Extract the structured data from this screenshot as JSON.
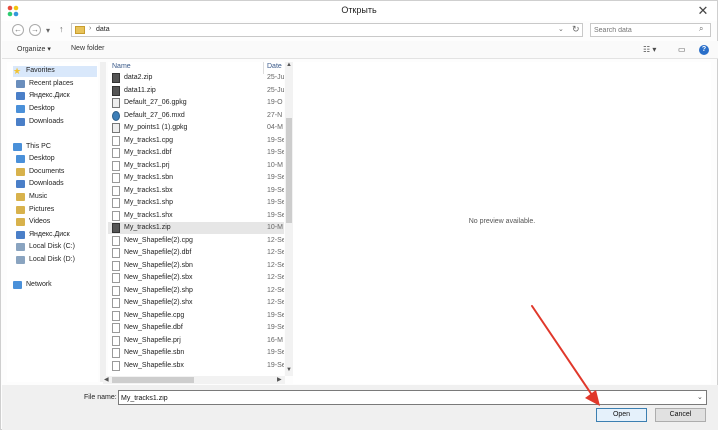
{
  "window": {
    "title": "Открыть",
    "close_glyph": "✕",
    "app_icon": "app-icon"
  },
  "address_bar": {
    "back_glyph": "←",
    "forward_glyph": "→",
    "recent_glyph": "▾",
    "up_glyph": "↑",
    "breadcrumb_separator": "›",
    "path": "data",
    "dropdown_glyph": "⌄",
    "refresh_glyph": "↻"
  },
  "search": {
    "placeholder": "Search data",
    "icon_glyph": "⌕"
  },
  "toolbar": {
    "organize_label": "Organize ▾",
    "new_folder_label": "New folder",
    "view_glyph": "☷ ▾",
    "pane_glyph": "▭",
    "help_glyph": "?"
  },
  "nav_pane": {
    "items": [
      {
        "label": "Favorites",
        "icon": "star-icon",
        "color": "#f1c232",
        "selected": true
      },
      {
        "label": "Recent places",
        "icon": "recent-places-icon",
        "color": "#6a8ebd"
      },
      {
        "label": "Яндекс.Диск",
        "icon": "yandex-disk-icon",
        "color": "#4a7fc8"
      },
      {
        "label": "Desktop",
        "icon": "desktop-icon",
        "color": "#4a90d9"
      },
      {
        "label": "Downloads",
        "icon": "downloads-icon",
        "color": "#4a7fc8"
      },
      {
        "label": "This PC",
        "icon": "computer-icon",
        "color": "#4a90d9"
      },
      {
        "label": "Desktop",
        "icon": "desktop-icon",
        "color": "#4a90d9"
      },
      {
        "label": "Documents",
        "icon": "documents-icon",
        "color": "#d8b24c"
      },
      {
        "label": "Downloads",
        "icon": "downloads-icon",
        "color": "#4a7fc8"
      },
      {
        "label": "Music",
        "icon": "music-icon",
        "color": "#d8b24c"
      },
      {
        "label": "Pictures",
        "icon": "pictures-icon",
        "color": "#d8b24c"
      },
      {
        "label": "Videos",
        "icon": "videos-icon",
        "color": "#d8b24c"
      },
      {
        "label": "Яндекс.Диск",
        "icon": "yandex-disk-icon",
        "color": "#4a7fc8"
      },
      {
        "label": "Local Disk (C:)",
        "icon": "drive-icon",
        "color": "#8aa4c0"
      },
      {
        "label": "Local Disk (D:)",
        "icon": "drive-icon",
        "color": "#8aa4c0"
      },
      {
        "label": "Network",
        "icon": "network-icon",
        "color": "#4a90d9"
      }
    ]
  },
  "file_list": {
    "columns": {
      "name": "Name",
      "date": "Date"
    },
    "sort_glyph": "^",
    "files": [
      {
        "name": "data2.zip",
        "date": "25-Ju",
        "type": "zip"
      },
      {
        "name": "data11.zip",
        "date": "25-Ju",
        "type": "zip"
      },
      {
        "name": "Default_27_06.gpkg",
        "date": "19-O",
        "type": "gpkg"
      },
      {
        "name": "Default_27_06.mxd",
        "date": "27-N",
        "type": "mxd"
      },
      {
        "name": "My_points1 (1).gpkg",
        "date": "04-M",
        "type": "gpkg"
      },
      {
        "name": "My_tracks1.cpg",
        "date": "19-Se",
        "type": "file"
      },
      {
        "name": "My_tracks1.dbf",
        "date": "19-Se",
        "type": "file"
      },
      {
        "name": "My_tracks1.prj",
        "date": "10-M",
        "type": "file"
      },
      {
        "name": "My_tracks1.sbn",
        "date": "19-Se",
        "type": "file"
      },
      {
        "name": "My_tracks1.sbx",
        "date": "19-Se",
        "type": "file"
      },
      {
        "name": "My_tracks1.shp",
        "date": "19-Se",
        "type": "file"
      },
      {
        "name": "My_tracks1.shx",
        "date": "19-Se",
        "type": "file"
      },
      {
        "name": "My_tracks1.zip",
        "date": "10-M",
        "type": "zip",
        "selected": true
      },
      {
        "name": "New_Shapefile(2).cpg",
        "date": "12-Se",
        "type": "file"
      },
      {
        "name": "New_Shapefile(2).dbf",
        "date": "12-Se",
        "type": "file"
      },
      {
        "name": "New_Shapefile(2).sbn",
        "date": "12-Se",
        "type": "file"
      },
      {
        "name": "New_Shapefile(2).sbx",
        "date": "12-Se",
        "type": "file"
      },
      {
        "name": "New_Shapefile(2).shp",
        "date": "12-Se",
        "type": "file"
      },
      {
        "name": "New_Shapefile(2).shx",
        "date": "12-Se",
        "type": "file"
      },
      {
        "name": "New_Shapefile.cpg",
        "date": "19-Se",
        "type": "file"
      },
      {
        "name": "New_Shapefile.dbf",
        "date": "19-Se",
        "type": "file"
      },
      {
        "name": "New_Shapefile.prj",
        "date": "16-M",
        "type": "file"
      },
      {
        "name": "New_Shapefile.sbn",
        "date": "19-Se",
        "type": "file"
      },
      {
        "name": "New_Shapefile.sbx",
        "date": "19-Se",
        "type": "file"
      }
    ],
    "scroll_up": "▲",
    "scroll_down": "▼",
    "scroll_left": "◀",
    "scroll_right": "▶"
  },
  "preview": {
    "message": "No preview available."
  },
  "footer": {
    "file_name_label": "File name:",
    "file_name_value": "My_tracks1.zip",
    "dropdown_glyph": "⌄",
    "open_label": "Open",
    "cancel_label": "Cancel"
  },
  "annotation": {
    "arrow_color": "#e0382b"
  }
}
